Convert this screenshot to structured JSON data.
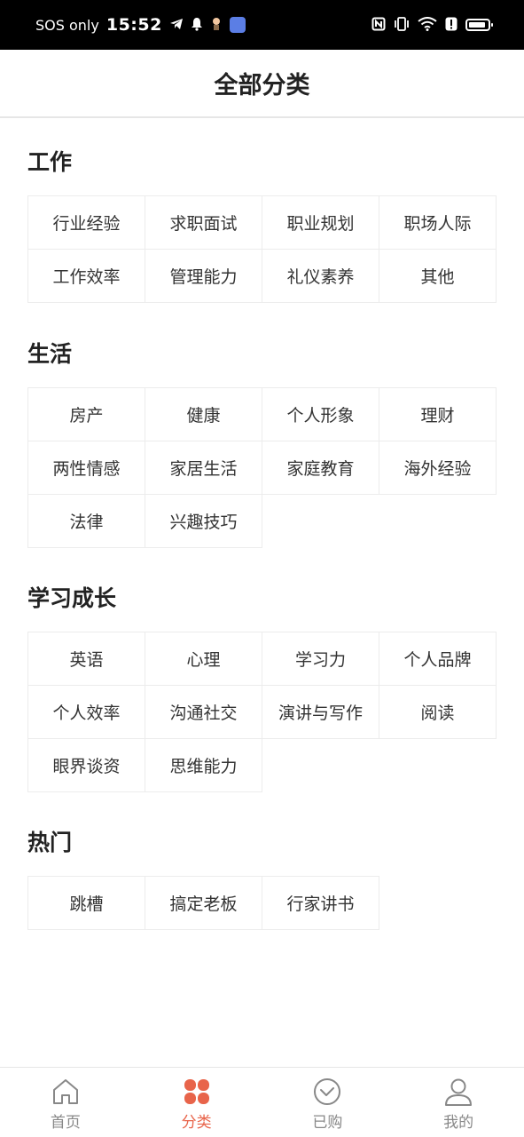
{
  "status_bar": {
    "carrier": "SOS only",
    "time": "15:52"
  },
  "header": {
    "title": "全部分类"
  },
  "sections": [
    {
      "title": "工作",
      "items": [
        "行业经验",
        "求职面试",
        "职业规划",
        "职场人际",
        "工作效率",
        "管理能力",
        "礼仪素养",
        "其他"
      ]
    },
    {
      "title": "生活",
      "items": [
        "房产",
        "健康",
        "个人形象",
        "理财",
        "两性情感",
        "家居生活",
        "家庭教育",
        "海外经验",
        "法律",
        "兴趣技巧"
      ]
    },
    {
      "title": "学习成长",
      "items": [
        "英语",
        "心理",
        "学习力",
        "个人品牌",
        "个人效率",
        "沟通社交",
        "演讲与写作",
        "阅读",
        "眼界谈资",
        "思维能力"
      ]
    },
    {
      "title": "热门",
      "items": [
        "跳槽",
        "搞定老板",
        "行家讲书"
      ]
    }
  ],
  "tab_bar": {
    "tabs": [
      {
        "label": "首页",
        "icon": "home-icon",
        "active": false
      },
      {
        "label": "分类",
        "icon": "category-icon",
        "active": true
      },
      {
        "label": "已购",
        "icon": "purchased-check-icon",
        "active": false
      },
      {
        "label": "我的",
        "icon": "profile-icon",
        "active": false
      }
    ],
    "active_color": "#e8644a",
    "inactive_color": "#888888"
  }
}
